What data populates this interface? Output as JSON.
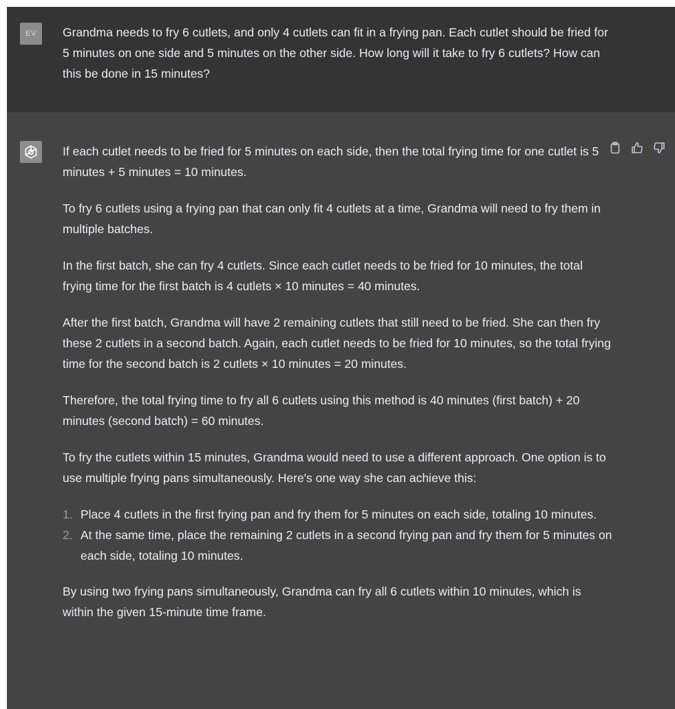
{
  "user": {
    "avatar_initials": "EV",
    "message": "Grandma needs to fry 6 cutlets, and only 4 cutlets can fit in a frying pan. Each cutlet should be fried for 5 minutes on one side and 5 minutes on the other side. How long will it take to fry 6 cutlets? How can this be done in 15 minutes?"
  },
  "assistant": {
    "avatar_icon": "openai-logo-icon",
    "paragraphs": [
      "If each cutlet needs to be fried for 5 minutes on each side, then the total frying time for one cutlet is 5 minutes + 5 minutes = 10 minutes.",
      "To fry 6 cutlets using a frying pan that can only fit 4 cutlets at a time, Grandma will need to fry them in multiple batches.",
      "In the first batch, she can fry 4 cutlets. Since each cutlet needs to be fried for 10 minutes, the total frying time for the first batch is 4 cutlets × 10 minutes = 40 minutes.",
      "After the first batch, Grandma will have 2 remaining cutlets that still need to be fried. She can then fry these 2 cutlets in a second batch. Again, each cutlet needs to be fried for 10 minutes, so the total frying time for the second batch is 2 cutlets × 10 minutes = 20 minutes.",
      "Therefore, the total frying time to fry all 6 cutlets using this method is 40 minutes (first batch) + 20 minutes (second batch) = 60 minutes.",
      "To fry the cutlets within 15 minutes, Grandma would need to use a different approach. One option is to use multiple frying pans simultaneously. Here's one way she can achieve this:"
    ],
    "list": [
      {
        "num": "1.",
        "text": "Place 4 cutlets in the first frying pan and fry them for 5 minutes on each side, totaling 10 minutes."
      },
      {
        "num": "2.",
        "text": "At the same time, place the remaining 2 cutlets in a second frying pan and fry them for 5 minutes on each side, totaling 10 minutes."
      }
    ],
    "closing": "By using two frying pans simultaneously, Grandma can fry all 6 cutlets within 10 minutes, which is within the given 15-minute time frame."
  },
  "actions": {
    "copy_icon": "clipboard-icon",
    "like_icon": "thumbs-up-icon",
    "dislike_icon": "thumbs-down-icon"
  },
  "colors": {
    "user_bg": "#343434",
    "assistant_bg": "#444444",
    "text": "#ececf1",
    "list_number": "#9a9a9a"
  }
}
